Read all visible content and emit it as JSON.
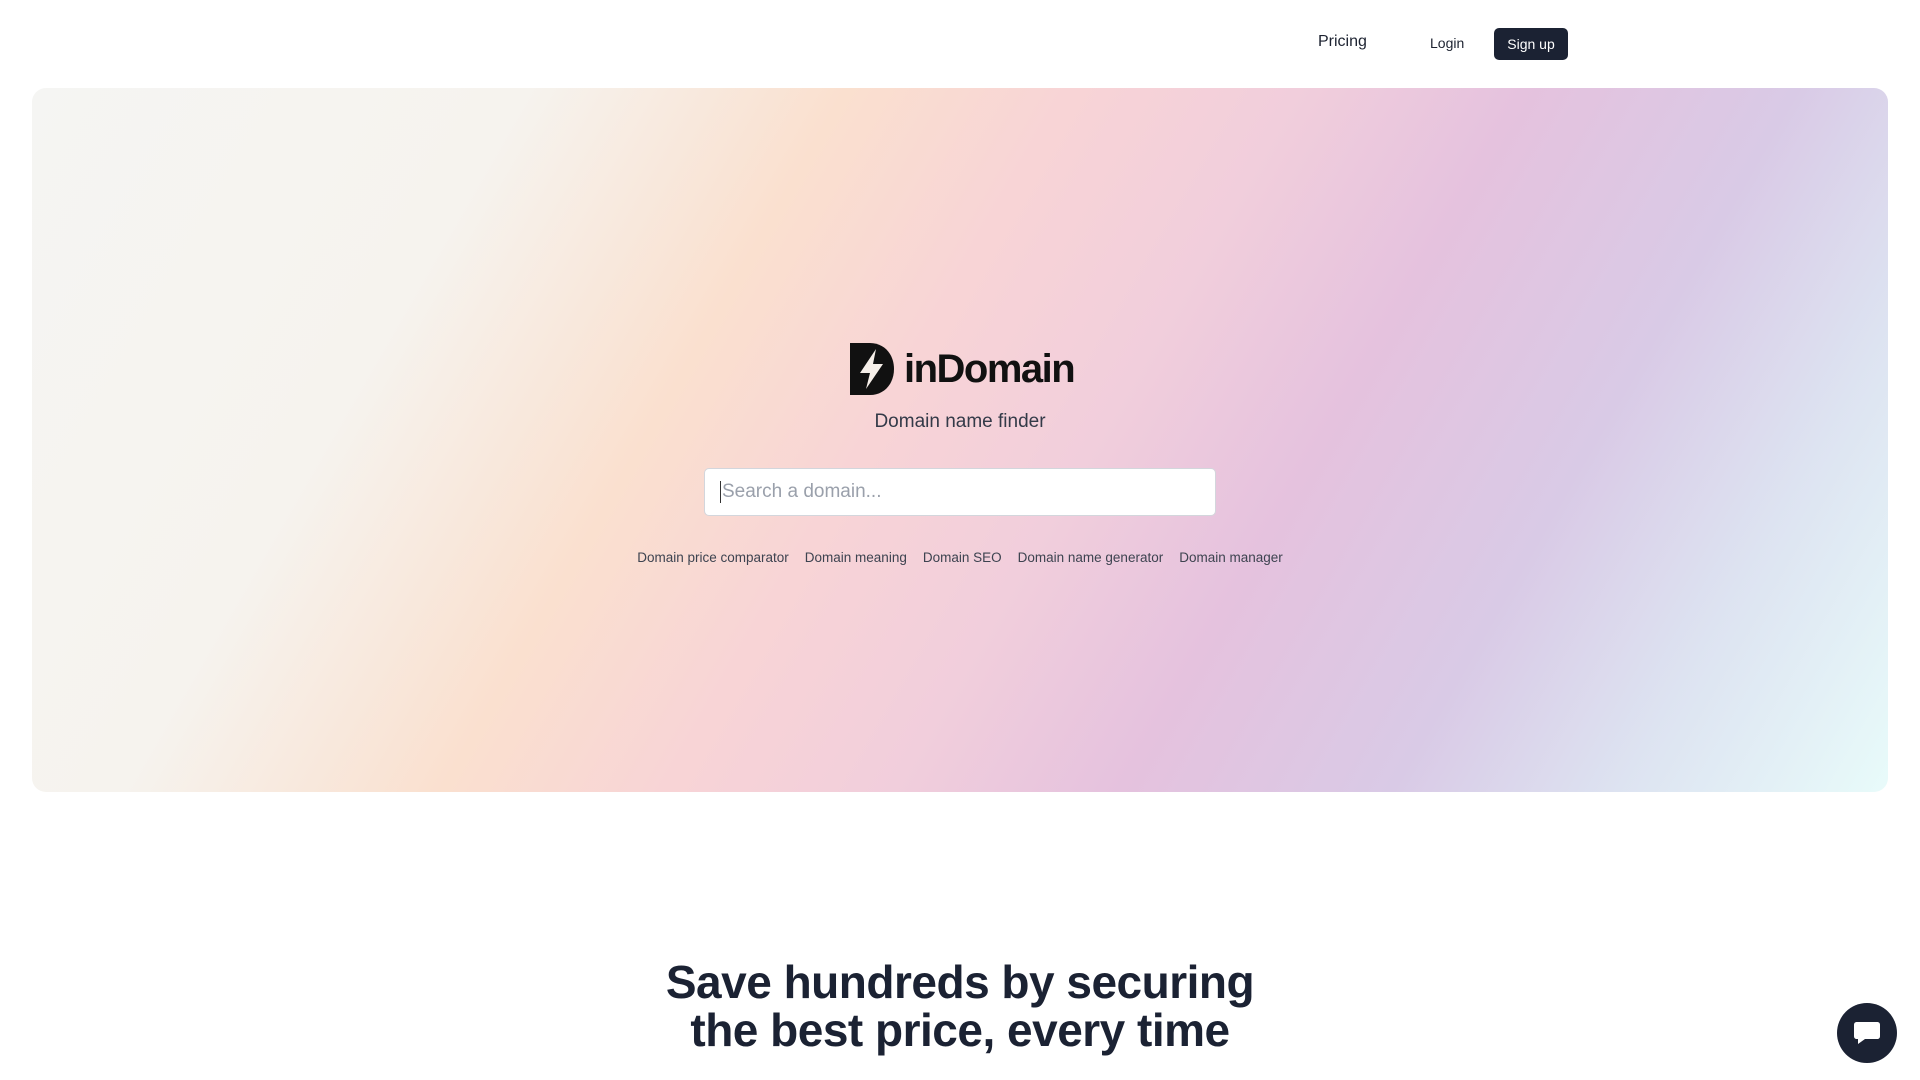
{
  "nav": {
    "pricing_label": "Pricing",
    "login_label": "Login",
    "signup_label": "Sign up"
  },
  "hero": {
    "brand_name": "inDomain",
    "tagline": "Domain name finder",
    "search": {
      "placeholder": "Search a domain...",
      "value": ""
    },
    "links": [
      "Domain price comparator",
      "Domain meaning",
      "Domain SEO",
      "Domain name generator",
      "Domain manager"
    ]
  },
  "section": {
    "headline_line1": "Save hundreds by securing",
    "headline_line2": "the best price, every time"
  },
  "icons": {
    "logo": "lightning-bolt-logo-icon",
    "chat": "chat-bubble-icon"
  },
  "colors": {
    "primary_dark": "#1b2233",
    "text": "#1c2230"
  }
}
